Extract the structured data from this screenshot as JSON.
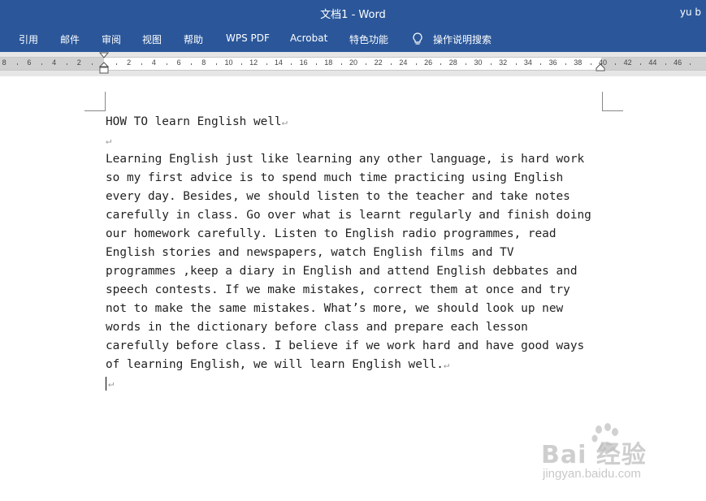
{
  "window": {
    "title": "文档1  -  Word",
    "user": "yu b"
  },
  "ribbon": {
    "tabs": [
      "引用",
      "邮件",
      "审阅",
      "视图",
      "帮助",
      "WPS PDF",
      "Acrobat",
      "特色功能"
    ],
    "tell_me": "操作说明搜索",
    "tell_me_icon": "lightbulb-icon"
  },
  "ruler": {
    "ticks": [
      "8",
      "6",
      "4",
      "2",
      "2",
      "4",
      "6",
      "8",
      "10",
      "12",
      "14",
      "16",
      "18",
      "20",
      "22",
      "24",
      "26",
      "28",
      "30",
      "32",
      "34",
      "36",
      "38",
      "40",
      "42",
      "44",
      "46"
    ]
  },
  "document": {
    "lines": [
      "HOW TO learn English well",
      "",
      "Learning English just like learning any other language, is hard work",
      "so my first advice is to spend much time practicing using English",
      "every day. Besides, we should listen to the teacher and take notes",
      "carefully in class. Go over what is learnt regularly and finish doing",
      "our homework carefully. Listen to English radio programmes, read",
      "English stories and newspapers, watch English films and TV",
      "programmes ,keep a diary in English and attend English debbates and",
      "speech contests. If we make mistakes, correct them at once and try",
      "not to make the same mistakes. What’s more, we should look up new",
      "words in the dictionary before class and prepare each lesson",
      "carefully before class. I believe if we work hard and have good ways",
      "of learning English, we will learn English well."
    ],
    "paragraph_mark": "↵"
  },
  "watermark": {
    "logo": "Bai  经验",
    "site": "jingyan.baidu.com"
  },
  "colors": {
    "ribbon": "#2b579a",
    "ruler_margin": "#d0d0d0"
  }
}
